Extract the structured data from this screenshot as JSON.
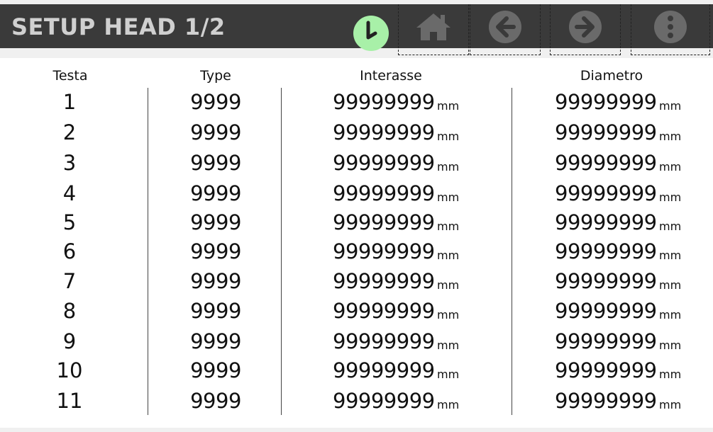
{
  "header": {
    "title": "SETUP HEAD 1/2"
  },
  "colors": {
    "header_bg": "#3a3a3a",
    "title_text": "#d0d0d0",
    "clock_fill": "#a8f0a8",
    "nav_icon": "#6a6a6a"
  },
  "nav": {
    "clock_icon": "clock-icon",
    "home_icon": "home-icon",
    "back_icon": "arrow-left-circle-icon",
    "forward_icon": "arrow-right-circle-icon",
    "menu_icon": "more-vertical-circle-icon"
  },
  "table": {
    "headers": {
      "testa": "Testa",
      "type": "Type",
      "interasse": "Interasse",
      "diametro": "Diametro"
    },
    "rows": [
      {
        "testa": "1",
        "type": "9999",
        "interasse": "99999999",
        "interasse_unit": "mm",
        "diametro": "99999999",
        "diametro_unit": "mm"
      },
      {
        "testa": "2",
        "type": "9999",
        "interasse": "99999999",
        "interasse_unit": "mm",
        "diametro": "99999999",
        "diametro_unit": "mm"
      },
      {
        "testa": "3",
        "type": "9999",
        "interasse": "99999999",
        "interasse_unit": "mm",
        "diametro": "99999999",
        "diametro_unit": "mm"
      },
      {
        "testa": "4",
        "type": "9999",
        "interasse": "99999999",
        "interasse_unit": "mm",
        "diametro": "99999999",
        "diametro_unit": "mm"
      },
      {
        "testa": "5",
        "type": "9999",
        "interasse": "99999999",
        "interasse_unit": "mm",
        "diametro": "99999999",
        "diametro_unit": "mm"
      },
      {
        "testa": "6",
        "type": "9999",
        "interasse": "99999999",
        "interasse_unit": "mm",
        "diametro": "99999999",
        "diametro_unit": "mm"
      },
      {
        "testa": "7",
        "type": "9999",
        "interasse": "99999999",
        "interasse_unit": "mm",
        "diametro": "99999999",
        "diametro_unit": "mm"
      },
      {
        "testa": "8",
        "type": "9999",
        "interasse": "99999999",
        "interasse_unit": "mm",
        "diametro": "99999999",
        "diametro_unit": "mm"
      },
      {
        "testa": "9",
        "type": "9999",
        "interasse": "99999999",
        "interasse_unit": "mm",
        "diametro": "99999999",
        "diametro_unit": "mm"
      },
      {
        "testa": "10",
        "type": "9999",
        "interasse": "99999999",
        "interasse_unit": "mm",
        "diametro": "99999999",
        "diametro_unit": "mm"
      },
      {
        "testa": "11",
        "type": "9999",
        "interasse": "99999999",
        "interasse_unit": "mm",
        "diametro": "99999999",
        "diametro_unit": "mm"
      }
    ]
  }
}
